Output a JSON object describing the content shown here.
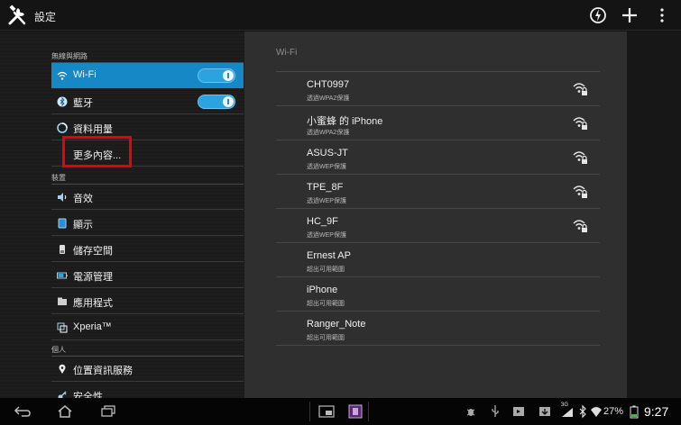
{
  "app": {
    "title": "設定",
    "icon": "tools-icon"
  },
  "actionbar": {
    "actions": [
      "sync-icon",
      "add-icon",
      "overflow-icon"
    ]
  },
  "sidebar": {
    "sections": [
      {
        "header": "無線與網路"
      },
      {
        "header": "裝置"
      },
      {
        "header": "個人"
      }
    ],
    "items": [
      {
        "label": "Wi-Fi",
        "icon": "wifi-icon",
        "toggle": "on"
      },
      {
        "label": "藍牙",
        "icon": "bluetooth-icon",
        "toggle": "on"
      },
      {
        "label": "資料用量",
        "icon": "data-usage-icon"
      },
      {
        "label": "更多內容..."
      },
      {
        "label": "音效",
        "icon": "sound-icon"
      },
      {
        "label": "顯示",
        "icon": "display-icon"
      },
      {
        "label": "儲存空間",
        "icon": "storage-icon"
      },
      {
        "label": "電源管理",
        "icon": "battery-icon"
      },
      {
        "label": "應用程式",
        "icon": "apps-icon"
      },
      {
        "label": "Xperia™",
        "icon": "xperia-icon"
      },
      {
        "label": "位置資訊服務",
        "icon": "location-icon"
      },
      {
        "label": "安全性",
        "icon": "lock-icon"
      }
    ]
  },
  "wifi": {
    "header": "Wi-Fi",
    "networks": [
      {
        "ssid": "CHT0997",
        "status": "透過WPA2保護",
        "secured": true
      },
      {
        "ssid": "小蜜蜂 的 iPhone",
        "status": "透過WPA2保護",
        "secured": true
      },
      {
        "ssid": "ASUS-JT",
        "status": "透過WEP保護",
        "secured": true
      },
      {
        "ssid": "TPE_8F",
        "status": "透過WEP保護",
        "secured": true
      },
      {
        "ssid": "HC_9F",
        "status": "透過WEP保護",
        "secured": true
      },
      {
        "ssid": "Ernest AP",
        "status": "超出可用範圍",
        "secured": false
      },
      {
        "ssid": "iPhone",
        "status": "超出可用範圍",
        "secured": false
      },
      {
        "ssid": "Ranger_Note",
        "status": "超出可用範圍",
        "secured": false
      }
    ]
  },
  "statusbar": {
    "battery": "27%",
    "time": "9:27",
    "network": "3G"
  },
  "colors": {
    "accent": "#1688c6",
    "highlight": "#e8000d",
    "pane": "#2f2f2f"
  }
}
